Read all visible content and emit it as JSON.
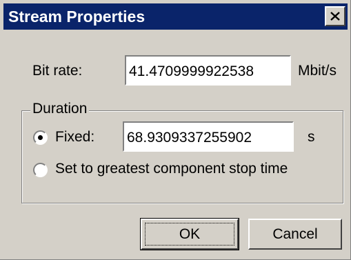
{
  "window": {
    "title": "Stream Properties",
    "close_icon": "close-x-icon"
  },
  "bitrate": {
    "label": "Bit rate:",
    "value": "41.4709999922538",
    "unit": "Mbit/s"
  },
  "duration": {
    "group_label": "Duration",
    "fixed_label": "Fixed:",
    "fixed_selected": true,
    "fixed_value": "68.9309337255902",
    "fixed_unit": "s",
    "greatest_label": "Set to greatest component stop time",
    "greatest_selected": false
  },
  "buttons": {
    "ok_label": "OK",
    "cancel_label": "Cancel"
  },
  "colors": {
    "titlebar": "#0a246a",
    "face": "#d4d0c8"
  }
}
